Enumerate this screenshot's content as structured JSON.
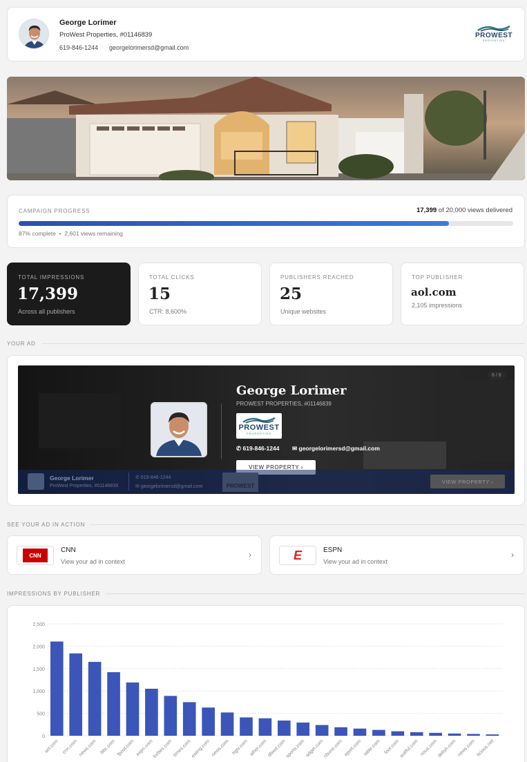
{
  "header": {
    "name": "George Lorimer",
    "company": "ProWest Properties, #01146839",
    "phone": "619-846-1244",
    "email": "georgelorimersd@gmail.com",
    "logo_name": "PROWEST",
    "logo_sub": "PROPERTIES"
  },
  "progress": {
    "label": "CAMPAIGN PROGRESS",
    "delivered": "17,399",
    "delivered_suffix": "of 20,000 views delivered",
    "fraction": 0.87,
    "complete": "87% complete",
    "sep": "•",
    "remaining": "2,601 views remaining"
  },
  "stats": [
    {
      "label": "TOTAL IMPRESSIONS",
      "value": "17,399",
      "sub": "Across all publishers"
    },
    {
      "label": "TOTAL CLICKS",
      "value": "15",
      "sub": "CTR: 8,600%"
    },
    {
      "label": "PUBLISHERS REACHED",
      "value": "25",
      "sub": "Unique websites"
    },
    {
      "label": "TOP PUBLISHER",
      "value": "aol.com",
      "sub": "2,105 impressions"
    }
  ],
  "your_ad": {
    "section_label": "YOUR AD",
    "name": "George Lorimer",
    "company": "PROWEST PROPERTIES, #01146839",
    "phone": "619-846-1244",
    "email": "georgelorimersd@gmail.com",
    "cta": "VIEW PROPERTY ›",
    "counter": "8 / 8",
    "strip_name": "George Lorimer",
    "strip_company": "ProWest Properties, #01146839",
    "strip_phone": "619-846-1244",
    "strip_email": "georgelorimersd@gmail.com",
    "strip_logo": "PROWEST",
    "strip_cta": "VIEW PROPERTY ›",
    "logo_name": "PROWEST",
    "logo_sub": "PROPERTIES"
  },
  "in_action": {
    "section_label": "SEE YOUR AD IN ACTION",
    "items": [
      {
        "name": "CNN",
        "sub": "View your ad in context",
        "logo": "CNN"
      },
      {
        "name": "ESPN",
        "sub": "View your ad in context",
        "logo": "E"
      }
    ],
    "chevron": "›"
  },
  "chart_section_label": "IMPRESSIONS BY PUBLISHER",
  "chart_data": {
    "type": "bar",
    "title": "",
    "categories": [
      "aol.com",
      "cnn.com",
      "news.com",
      "bbc.com",
      "fpost.com",
      "espn.com",
      "forbes.com",
      "times.com",
      "esting.com",
      "news.com",
      "hgtv.com",
      "ather.com",
      "dfeed.com",
      "sports.com",
      "adget.com",
      "ribune.com",
      "eport.com",
      "iable.com",
      "fool.com",
      "autiful.com",
      "rious.com",
      "delish.com",
      "news.com",
      "licious.net"
    ],
    "values": [
      2105,
      1840,
      1650,
      1420,
      1190,
      1050,
      890,
      750,
      630,
      520,
      410,
      390,
      340,
      295,
      240,
      190,
      160,
      130,
      100,
      80,
      65,
      50,
      40,
      30
    ],
    "yticks": [
      "0",
      "500",
      "1,000",
      "1,500",
      "2,000",
      "2,500"
    ],
    "ylim": [
      0,
      2500
    ],
    "grid": true,
    "color": "#3b56b8"
  }
}
